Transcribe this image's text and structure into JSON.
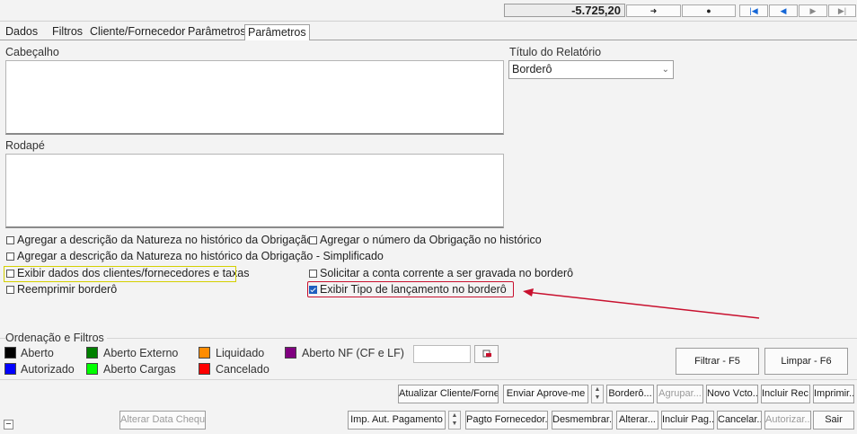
{
  "topbar": {
    "total": "-5.725,20",
    "nav_buttons": [
      {
        "symbol": "➜",
        "icon": "send-icon"
      },
      {
        "symbol": "●",
        "icon": "record-icon"
      },
      {
        "symbol": "|◀",
        "icon": "first-icon"
      },
      {
        "symbol": "◀",
        "icon": "prev-icon"
      },
      {
        "symbol": "▶",
        "icon": "next-icon"
      },
      {
        "symbol": "▶|",
        "icon": "last-icon"
      }
    ]
  },
  "tabs": [
    "Dados",
    "Filtros",
    "Cliente/Fornecedor",
    "Parâmetros",
    "Parâmetros do Borderô"
  ],
  "active_tab": "Parâmetros do Borderô",
  "form": {
    "header_label": "Cabeçalho",
    "footer_label": "Rodapé",
    "report_title_label": "Título do Relatório",
    "report_title_value": "Borderô"
  },
  "checkboxes": [
    {
      "label": "Agregar a descrição da Natureza no histórico da Obrigação",
      "checked": false
    },
    {
      "label": "Agregar o número da Obrigação no histórico",
      "checked": false
    },
    {
      "label": "Agregar a descrição da Natureza no histórico da Obrigação - Simplificado",
      "checked": false
    },
    {
      "label": "Exibir dados dos clientes/fornecedores e taxas",
      "checked": false
    },
    {
      "label": "Solicitar a conta corrente a ser gravada no borderô",
      "checked": false
    },
    {
      "label": "Reemprimir borderô",
      "checked": false
    },
    {
      "label": "Exibir Tipo de lançamento no borderô",
      "checked": true
    }
  ],
  "ordering": {
    "title": "Ordenação e Filtros",
    "legend": [
      {
        "label": "Aberto",
        "color": "#000000"
      },
      {
        "label": "Aberto Externo",
        "color": "#008000"
      },
      {
        "label": "Liquidado",
        "color": "#ff8c00"
      },
      {
        "label": "Aberto NF (CF e LF)",
        "color": "#800080"
      },
      {
        "label": "Autorizado",
        "color": "#0000ff"
      },
      {
        "label": "Aberto Cargas",
        "color": "#00ff00"
      },
      {
        "label": "Cancelado",
        "color": "#ff0000"
      }
    ]
  },
  "buttons": {
    "filter": "Filtrar - F5",
    "clear": "Limpar - F6",
    "update_client": "Atualizar Cliente/Fornec",
    "send_approve": "Enviar Aprove-me",
    "bordero": "Borderô...",
    "group": "Agrupar...",
    "new_due": "Novo Vcto...",
    "include_rec": "Incluir Rec...",
    "print": "Imprimir...",
    "alter_check_date": "Alterar Data Cheque",
    "imp_aut_payment": "Imp. Aut. Pagamento",
    "pay_supplier": "Pagto Fornecedor...",
    "split": "Desmembrar...",
    "alter": "Alterar...",
    "include_pay": "Incluir Pag...",
    "cancel": "Cancelar...",
    "authorize": "Autorizar...",
    "exit": "Sair"
  },
  "colors": {
    "highlight_yellow": "#d4d000",
    "highlight_red": "#c8102e",
    "accent_blue": "#1566d6"
  }
}
